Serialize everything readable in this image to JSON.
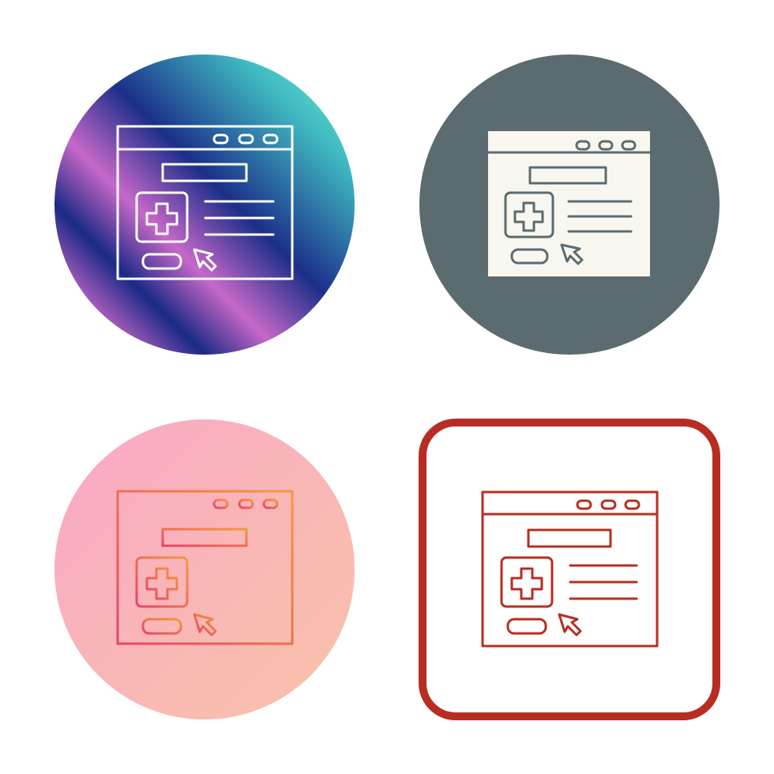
{
  "icon_set": {
    "subject": "medical-website-icon",
    "variants": [
      {
        "style": "gradient-circle",
        "colors": {
          "stops": [
            "#6ff5d2",
            "#1c2f8a",
            "#c768c9",
            "#1a2a86",
            "#c768c9",
            "#2f3f9a"
          ],
          "stroke": "#ffffff"
        }
      },
      {
        "style": "glyph-circle",
        "colors": {
          "background": "#5b6b70",
          "fill": "#f7f7ef",
          "stroke": "#5b6b70"
        }
      },
      {
        "style": "gradient-line-circle",
        "colors": {
          "background_stops": [
            "#f9a7c7",
            "#f9c4a8"
          ],
          "stroke_stops": [
            "#e8436a",
            "#f39b3a"
          ]
        }
      },
      {
        "style": "outline-rounded-square",
        "colors": {
          "frame": "#b82d22",
          "stroke": "#b82d22",
          "background": "#ffffff"
        }
      }
    ]
  }
}
